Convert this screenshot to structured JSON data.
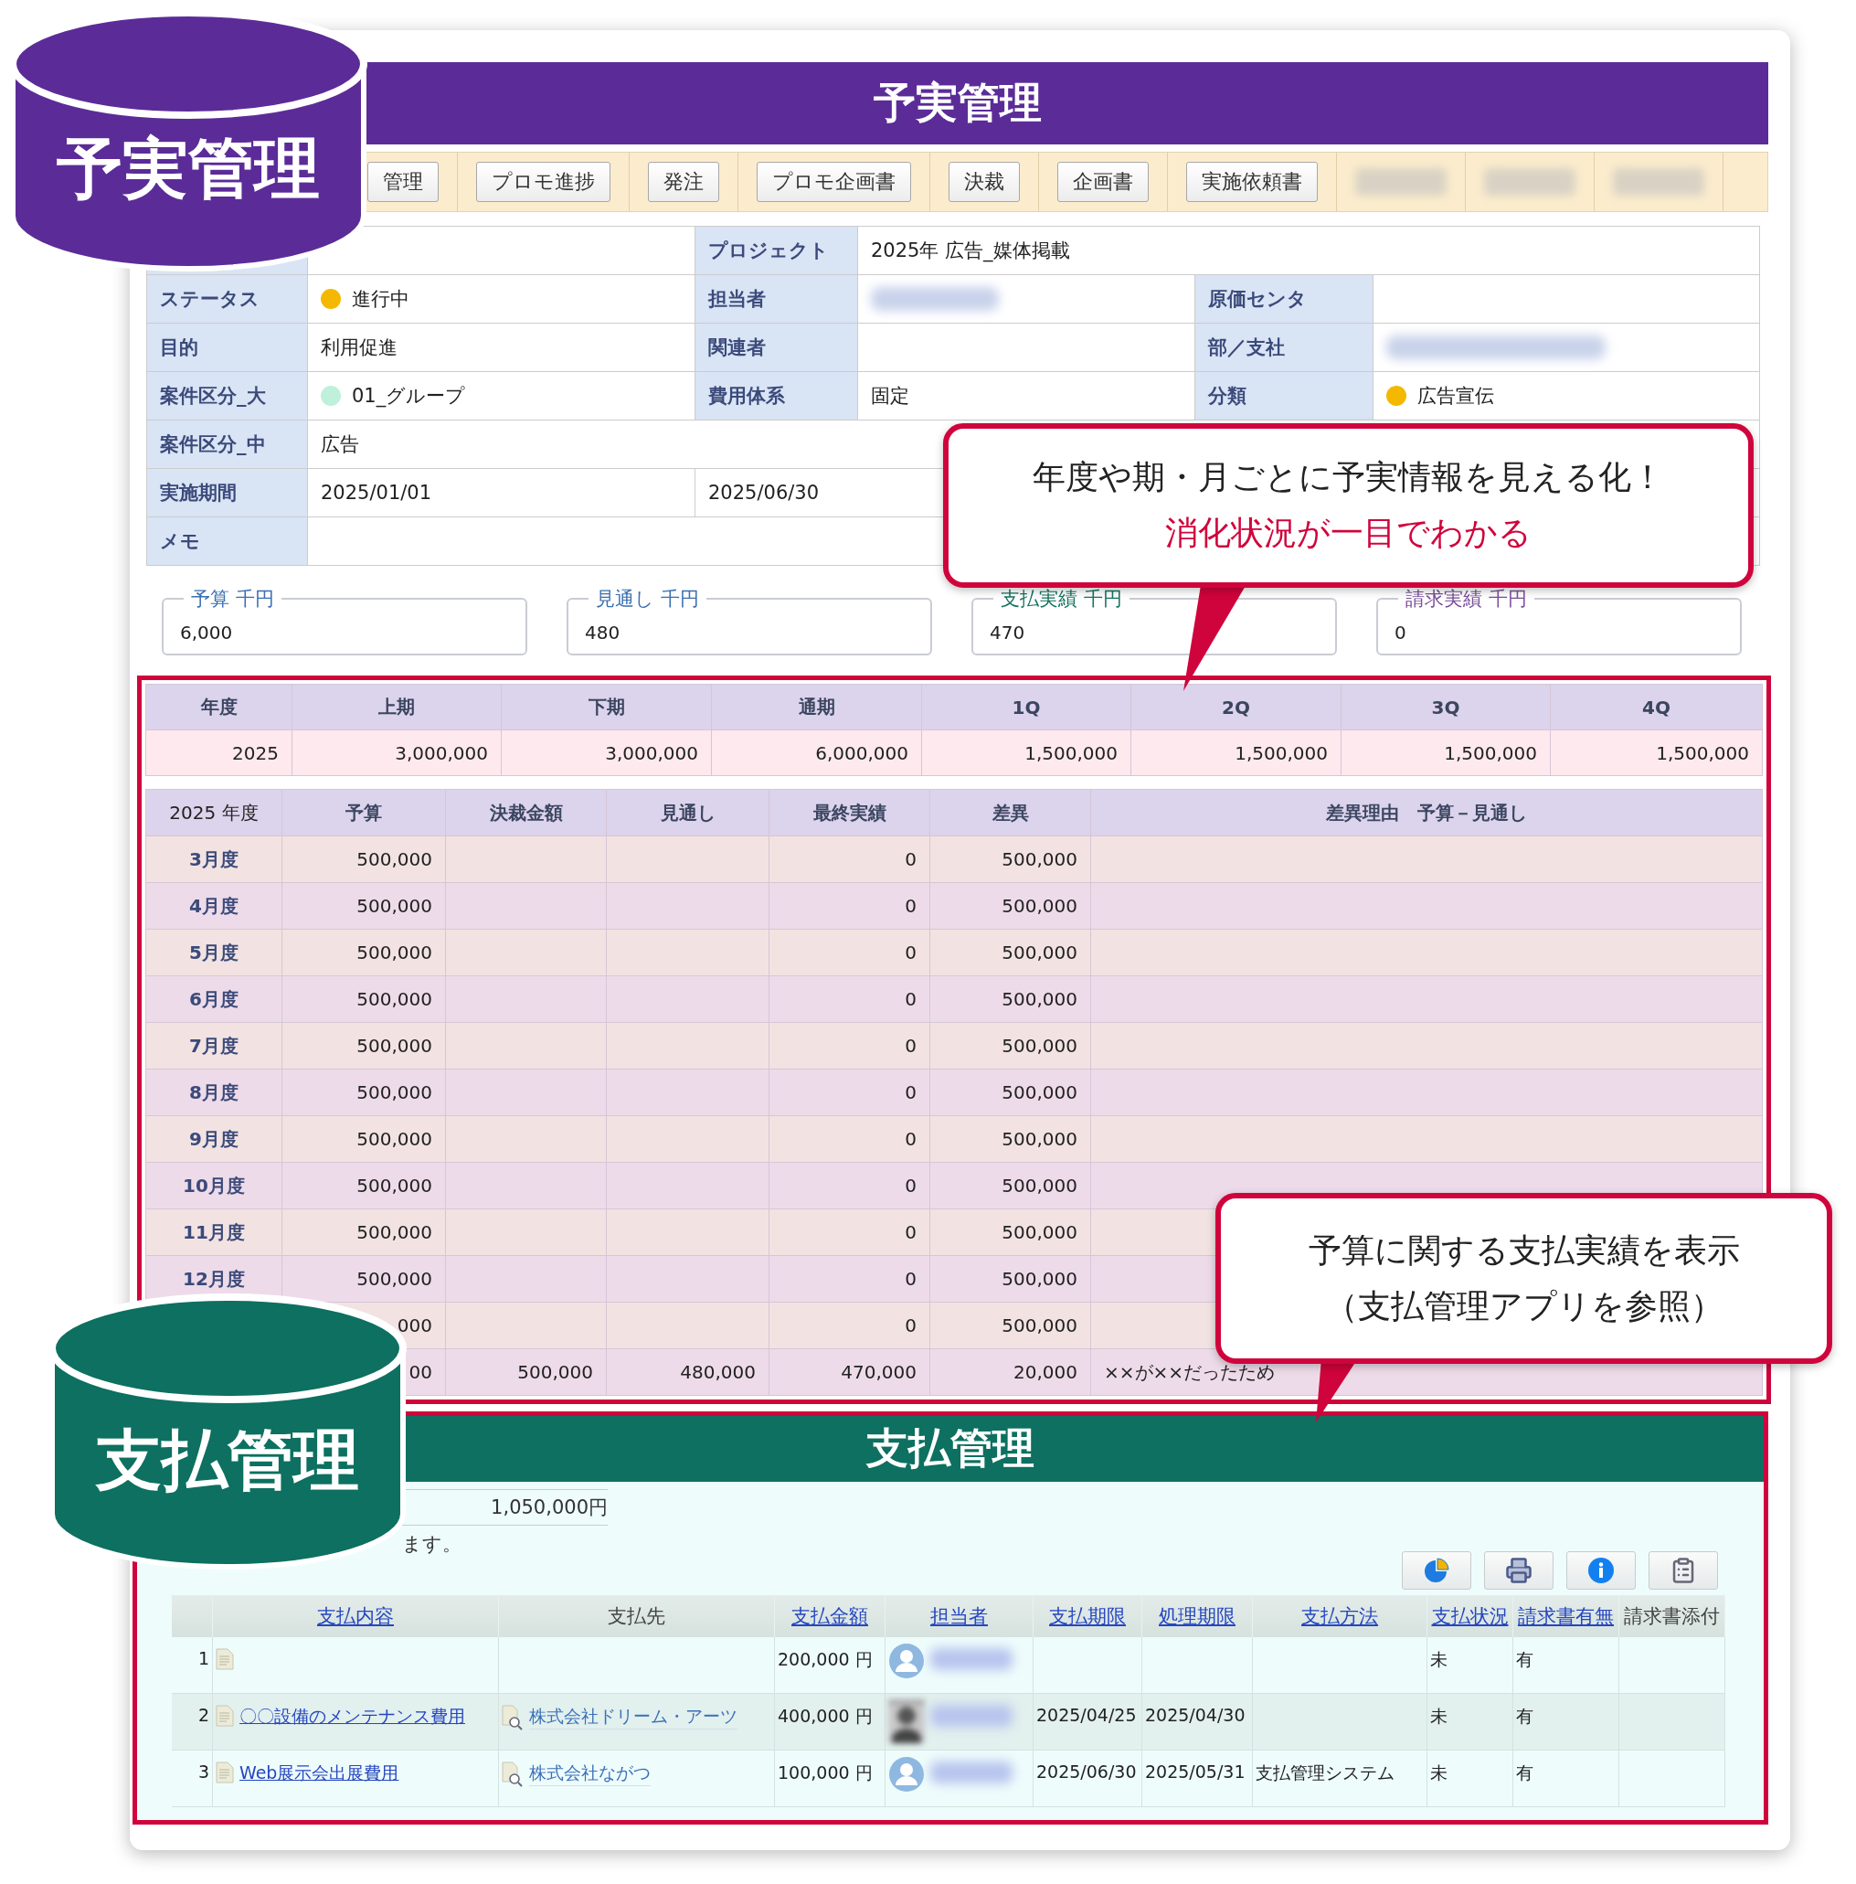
{
  "badges": [
    {
      "label": "予実管理",
      "color": "#5b2c98"
    },
    {
      "label": "支払管理",
      "color": "#0d7060"
    }
  ],
  "callouts": [
    {
      "lines": [
        {
          "text": "年度や期・月ごとに予実情報を見える化！",
          "kind": "plain"
        },
        {
          "text": "消化状況が一目でわかる",
          "kind": "accent"
        }
      ]
    },
    {
      "lines": [
        {
          "text": "予算に関する支払実績を表示",
          "kind": "plain"
        },
        {
          "text": "（支払管理アプリを参照）",
          "kind": "plain"
        }
      ]
    }
  ],
  "budget_app": {
    "title": "予実管理",
    "tabs": [
      {
        "kind": "button",
        "label": "管理"
      },
      {
        "kind": "button",
        "label": "プロモ進捗"
      },
      {
        "kind": "button",
        "label": "発注"
      },
      {
        "kind": "button",
        "label": "プロモ企画書"
      },
      {
        "kind": "button",
        "label": "決裁"
      },
      {
        "kind": "button",
        "label": "企画書"
      },
      {
        "kind": "button",
        "label": "実施依頼書"
      },
      {
        "kind": "blurred"
      },
      {
        "kind": "blurred"
      },
      {
        "kind": "blurred"
      }
    ],
    "info": {
      "rows": [
        [
          {
            "kind": "label"
          },
          {
            "kind": "value"
          },
          {
            "kind": "label",
            "text": "プロジェクト"
          },
          {
            "kind": "value",
            "text": "2025年 広告_媒体掲載",
            "wide": true
          }
        ],
        [
          {
            "kind": "label",
            "text": "ステータス"
          },
          {
            "kind": "value",
            "text": "進行中",
            "color": "#f5b800"
          },
          {
            "kind": "label",
            "text": "担当者"
          },
          {
            "kind": "blurred"
          },
          {
            "kind": "label",
            "text": "原価センタ"
          },
          {
            "kind": "value"
          }
        ],
        [
          {
            "kind": "label",
            "text": "目的"
          },
          {
            "kind": "value",
            "text": "利用促進"
          },
          {
            "kind": "label",
            "text": "関連者"
          },
          {
            "kind": "value"
          },
          {
            "kind": "label",
            "text": "部／支社"
          },
          {
            "kind": "blurred"
          }
        ],
        [
          {
            "kind": "label",
            "text": "案件区分_大"
          },
          {
            "kind": "value",
            "text": "01_グループ",
            "color": "#bff0dc"
          },
          {
            "kind": "label",
            "text": "費用体系"
          },
          {
            "kind": "value",
            "text": "固定"
          },
          {
            "kind": "label",
            "text": "分類"
          },
          {
            "kind": "value",
            "text": "広告宣伝",
            "color": "#f5b800"
          }
        ],
        [
          {
            "kind": "label",
            "text": "案件区分_中"
          },
          {
            "kind": "value",
            "text": "広告",
            "wide": true
          }
        ],
        [
          {
            "kind": "label",
            "text": "実施期間"
          },
          {
            "kind": "value",
            "text": "2025/01/01"
          },
          {
            "kind": "value",
            "text": "2025/06/30",
            "wide": true
          }
        ],
        [
          {
            "kind": "label",
            "text": "メモ"
          },
          {
            "kind": "value",
            "wide": true
          }
        ]
      ]
    },
    "summary": [
      {
        "label": "予算 千円",
        "value": "6,000",
        "color": "#3a6fb0"
      },
      {
        "label": "見通し 千円",
        "value": "480",
        "color": "#3a6fb0"
      },
      {
        "label": "支払実績 千円",
        "value": "470",
        "color": "#16735f"
      },
      {
        "label": "請求実績 千円",
        "value": "0",
        "color": "#7a4f9a"
      }
    ],
    "quarters": {
      "columns": [
        "年度",
        "上期",
        "下期",
        "通期",
        "1Q",
        "2Q",
        "3Q",
        "4Q"
      ],
      "rows": [
        [
          "2025",
          "3,000,000",
          "3,000,000",
          "6,000,000",
          "1,500,000",
          "1,500,000",
          "1,500,000",
          "1,500,000"
        ]
      ]
    },
    "monthly": {
      "columns": [
        "2025 年度",
        "予算",
        "決裁金額",
        "見通し",
        "最終実績",
        "差異",
        "差異理由　予算－見通し"
      ],
      "rows": [
        {
          "month": "3月度",
          "budget": "500,000",
          "actual": "0",
          "diff": "500,000"
        },
        {
          "month": "4月度",
          "budget": "500,000",
          "actual": "0",
          "diff": "500,000"
        },
        {
          "month": "5月度",
          "budget": "500,000",
          "actual": "0",
          "diff": "500,000"
        },
        {
          "month": "6月度",
          "budget": "500,000",
          "actual": "0",
          "diff": "500,000"
        },
        {
          "month": "7月度",
          "budget": "500,000",
          "actual": "0",
          "diff": "500,000"
        },
        {
          "month": "8月度",
          "budget": "500,000",
          "actual": "0",
          "diff": "500,000"
        },
        {
          "month": "9月度",
          "budget": "500,000",
          "actual": "0",
          "diff": "500,000"
        },
        {
          "month": "10月度",
          "budget": "500,000",
          "actual": "0",
          "diff": "500,000"
        },
        {
          "month": "11月度",
          "budget": "500,000",
          "actual": "0",
          "diff": "500,000"
        },
        {
          "month": "12月度",
          "budget": "500,000",
          "actual": "0",
          "diff": "500,000"
        },
        {
          "budget": "000",
          "actual": "0",
          "diff": "500,000"
        },
        {
          "budget": "00",
          "approved": "500,000",
          "forecast": "480,000",
          "actual": "470,000",
          "diff": "20,000",
          "reason": "××が××だったため"
        }
      ]
    }
  },
  "payment_app": {
    "title": "支払管理",
    "total": "1,050,000円",
    "note": "ます。",
    "columns": [
      {
        "label": "支払内容",
        "link": true
      },
      {
        "label": "支払先",
        "link": false
      },
      {
        "label": "支払金額",
        "link": true
      },
      {
        "label": "担当者",
        "link": true
      },
      {
        "label": "支払期限",
        "link": true
      },
      {
        "label": "処理期限",
        "link": true
      },
      {
        "label": "支払方法",
        "link": true
      },
      {
        "label": "支払状況",
        "link": true
      },
      {
        "label": "請求書有無",
        "link": true
      },
      {
        "label": "請求書添付",
        "link": false
      }
    ],
    "rows": [
      {
        "no": "1",
        "amount": "200,000 円",
        "kind": "silhouette",
        "status": "未",
        "invoice": "有"
      },
      {
        "no": "2",
        "content": "〇〇設備のメンテナンス費用",
        "payee": "株式会社ドリーム・アーツ",
        "amount": "400,000 円",
        "due": "2025/04/25",
        "deadline": "2025/04/30",
        "status": "未",
        "invoice": "有"
      },
      {
        "no": "3",
        "content": "Web展示会出展費用",
        "payee": "株式会社ながつ",
        "amount": "100,000 円",
        "kind": "silhouette",
        "due": "2025/06/30",
        "deadline": "2025/05/31",
        "method": "支払管理システム",
        "status": "未",
        "invoice": "有"
      }
    ]
  }
}
